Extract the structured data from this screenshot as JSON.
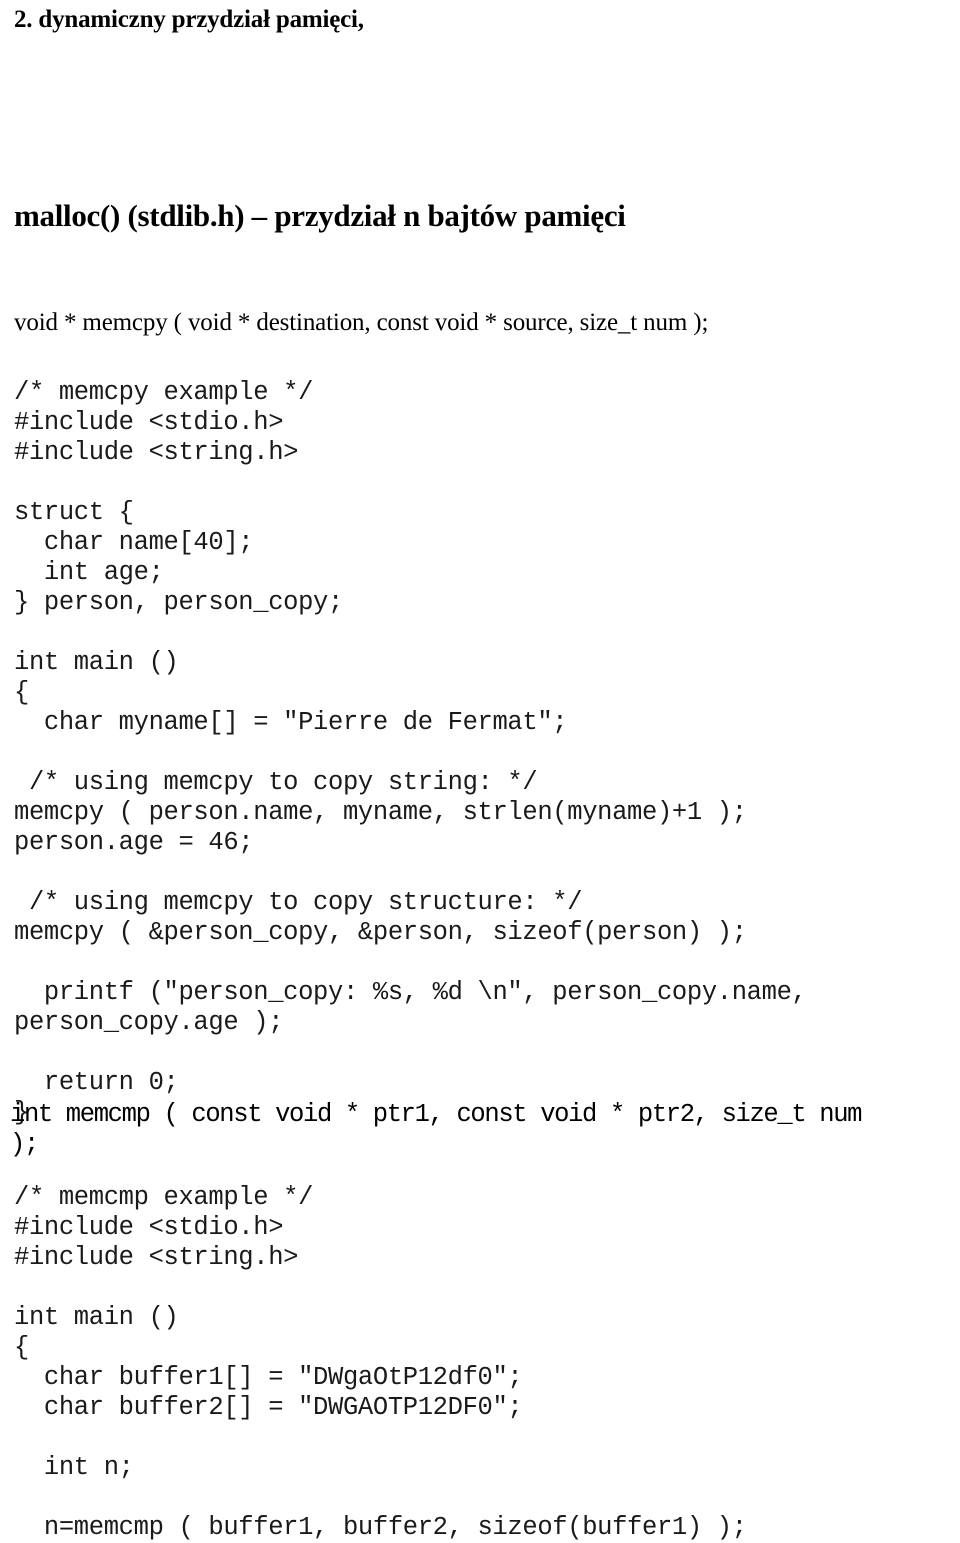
{
  "document": {
    "section_heading": "2. dynamiczny przydział pamięci,",
    "topic_heading": "malloc() (stdlib.h) – przydział n bajtów pamięci",
    "memcpy_prototype": "void * memcpy ( void * destination, const void * source, size_t num );",
    "memcmp_prototype_line1": "int memcmp ( const void * ptr1, const void * ptr2, size_t num",
    "memcmp_prototype_line2": ");"
  },
  "code_memcpy": {
    "lines": [
      "/* memcpy example */",
      "#include <stdio.h>",
      "#include <string.h>",
      "",
      "struct {",
      "  char name[40];",
      "  int age;",
      "} person, person_copy;",
      "",
      "int main ()",
      "{",
      "  char myname[] = \"Pierre de Fermat\";",
      "",
      " /* using memcpy to copy string: */",
      "memcpy ( person.name, myname, strlen(myname)+1 );",
      "person.age = 46;",
      "",
      " /* using memcpy to copy structure: */",
      "memcpy ( &person_copy, &person, sizeof(person) );",
      "",
      "  printf (\"person_copy: %s, %d \\n\", person_copy.name,",
      "person_copy.age );",
      "",
      "  return 0;",
      "}"
    ]
  },
  "code_memcmp": {
    "lines": [
      "/* memcmp example */",
      "#include <stdio.h>",
      "#include <string.h>",
      "",
      "int main ()",
      "{",
      "  char buffer1[] = \"DWgaOtP12df0\";",
      "  char buffer2[] = \"DWGAOTP12DF0\";",
      "",
      "  int n;",
      "",
      "  n=memcmp ( buffer1, buffer2, sizeof(buffer1) );"
    ]
  }
}
